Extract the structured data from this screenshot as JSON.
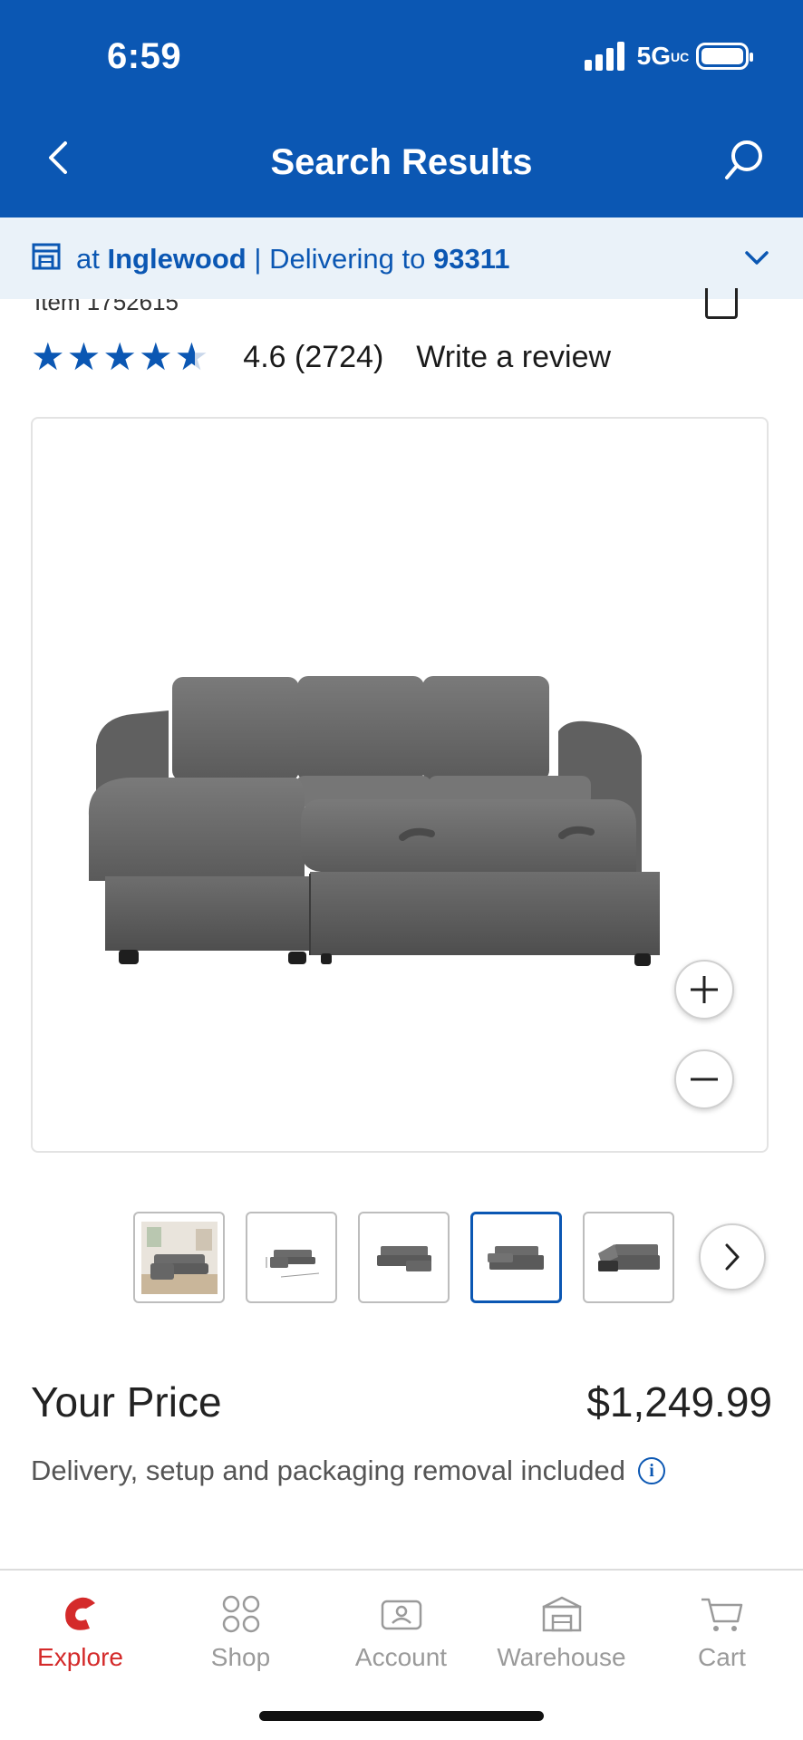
{
  "status_bar": {
    "time": "6:59",
    "network": "5G",
    "network_suffix": "UC"
  },
  "nav": {
    "title": "Search Results",
    "back_icon": "chevron-left-icon",
    "search_icon": "search-icon"
  },
  "store_bar": {
    "prefix": "at",
    "store": "Inglewood",
    "separator": "|",
    "delivering_label": "Delivering to",
    "zip": "93311"
  },
  "product": {
    "item_number": "Item 1752615",
    "rating_value": 4.6,
    "rating": "4.6",
    "review_count": "(2724)",
    "write_review": "Write a review",
    "image_description": "Gray sleeper sectional sofa with chaise",
    "thumbnail_count": 5,
    "active_thumbnail_index": 3,
    "price_label": "Your Price",
    "price": "$1,249.99",
    "delivery_note": "Delivery, setup and packaging removal included"
  },
  "tabbar": {
    "items": [
      {
        "label": "Explore",
        "icon": "costco-logo-icon",
        "active": true
      },
      {
        "label": "Shop",
        "icon": "grid-icon",
        "active": false
      },
      {
        "label": "Account",
        "icon": "account-icon",
        "active": false
      },
      {
        "label": "Warehouse",
        "icon": "warehouse-icon",
        "active": false
      },
      {
        "label": "Cart",
        "icon": "cart-icon",
        "active": false
      }
    ]
  },
  "colors": {
    "brand_blue": "#0b57b3",
    "store_bar_bg": "#eaf2f9",
    "explore_red": "#d42a2a",
    "inactive_gray": "#9a9a9a"
  }
}
